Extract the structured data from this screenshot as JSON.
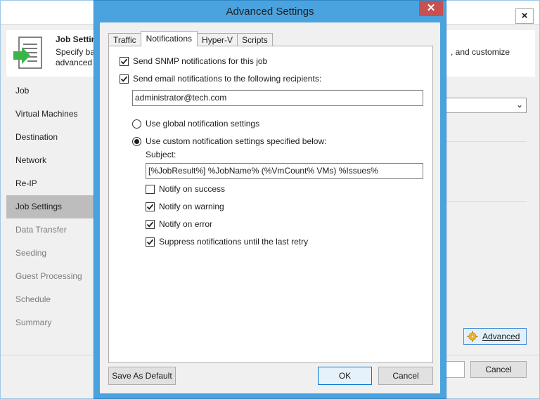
{
  "wizard": {
    "close_glyph": "×",
    "header": {
      "title": "Job Settin",
      "desc_line1": "Specify ba",
      "desc_line2": "advanced",
      "desc_right": ", and customize"
    },
    "nav": [
      {
        "label": "Job",
        "state": "normal"
      },
      {
        "label": "Virtual Machines",
        "state": "normal"
      },
      {
        "label": "Destination",
        "state": "normal"
      },
      {
        "label": "Network",
        "state": "normal"
      },
      {
        "label": "Re-IP",
        "state": "normal"
      },
      {
        "label": "Job Settings",
        "state": "active"
      },
      {
        "label": "Data Transfer",
        "state": "muted"
      },
      {
        "label": "Seeding",
        "state": "muted"
      },
      {
        "label": "Guest Processing",
        "state": "muted"
      },
      {
        "label": "Schedule",
        "state": "muted"
      },
      {
        "label": "Summary",
        "state": "muted"
      }
    ],
    "advanced_label": "Advanced",
    "cancel_label": "Cancel"
  },
  "dialog": {
    "title": "Advanced Settings",
    "close_glyph": "✕",
    "tabs": [
      "Traffic",
      "Notifications",
      "Hyper-V",
      "Scripts"
    ],
    "active_tab": "Notifications",
    "snmp": {
      "label": "Send SNMP notifications for this job",
      "checked": true
    },
    "email": {
      "label": "Send email notifications to the following recipients:",
      "checked": true
    },
    "recipients_value": "administrator@tech.com",
    "radio_global": {
      "label": "Use global notification settings",
      "selected": false
    },
    "radio_custom": {
      "label": "Use custom notification settings specified below:",
      "selected": true
    },
    "subject_label": "Subject:",
    "subject_value": "[%JobResult%] %JobName% (%VmCount% VMs) %Issues%",
    "notify_success": {
      "label": "Notify on success",
      "checked": false
    },
    "notify_warning": {
      "label": "Notify on warning",
      "checked": true
    },
    "notify_error": {
      "label": "Notify on error",
      "checked": true
    },
    "suppress": {
      "label": "Suppress notifications until the last retry",
      "checked": true
    },
    "save_default_label": "Save As Default",
    "ok_label": "OK",
    "cancel_label": "Cancel"
  },
  "colors": {
    "dialog_frame": "#4aa3de",
    "close_red": "#c75050",
    "nav_active": "#bdbdbd",
    "button_focus": "#0078d7"
  }
}
